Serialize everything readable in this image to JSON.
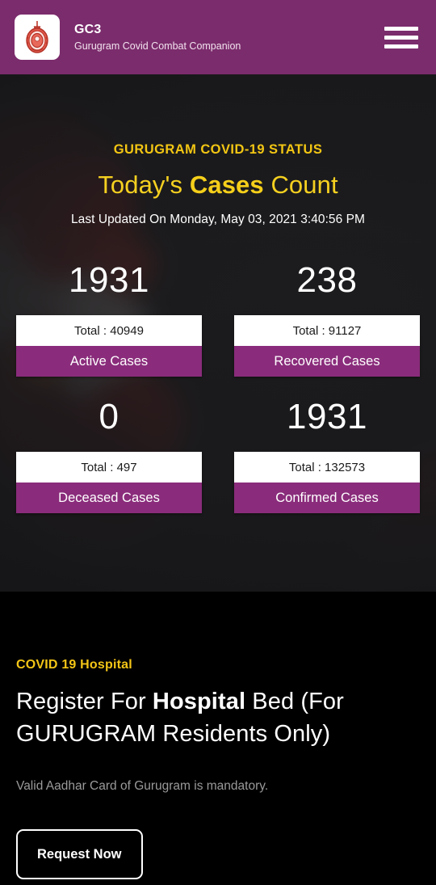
{
  "header": {
    "logo_icon": "haryana-government-emblem",
    "title": "GC3",
    "subtitle": "Gurugram Covid Combat Companion",
    "menu_icon": "hamburger-menu-icon"
  },
  "hero": {
    "kicker": "GURUGRAM COVID-19 STATUS",
    "heading_part1": "Today's ",
    "heading_bold": "Cases",
    "heading_part2": " Count",
    "last_updated": "Last Updated On Monday, May 03, 2021 3:40:56 PM"
  },
  "stats": [
    {
      "today": "1931",
      "total": "Total : 40949",
      "label": "Active Cases"
    },
    {
      "today": "238",
      "total": "Total : 91127",
      "label": "Recovered Cases"
    },
    {
      "today": "0",
      "total": "Total : 497",
      "label": "Deceased Cases"
    },
    {
      "today": "1931",
      "total": "Total : 132573",
      "label": "Confirmed Cases"
    }
  ],
  "promo": {
    "kicker": "COVID 19 Hospital",
    "heading_part1": "Register For ",
    "heading_bold": "Hospital",
    "heading_part2": " Bed (For GURUGRAM Residents Only)",
    "note": "Valid Aadhar Card of Gurugram is mandatory.",
    "cta_label": "Request Now"
  },
  "colors": {
    "header_purple": "#7b2c6c",
    "card_purple": "#8a2c7b",
    "accent_yellow": "#f5d020",
    "hero_bg": "#232325",
    "page_bg": "#000000"
  }
}
